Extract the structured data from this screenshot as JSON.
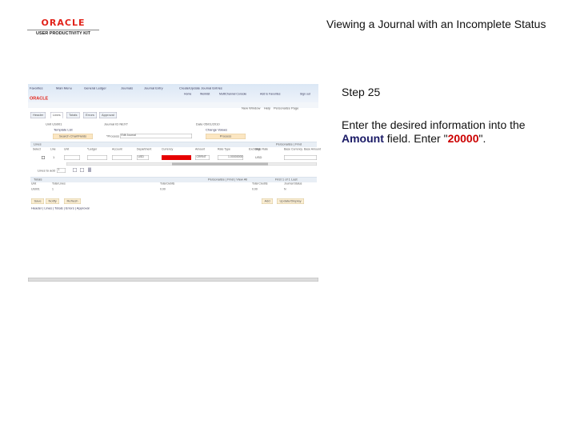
{
  "logo": {
    "brand": "ORACLE",
    "product": "USER PRODUCTIVITY KIT"
  },
  "slide": {
    "title": "Viewing a Journal with an Incomplete Status",
    "step": "Step 25",
    "instr_pre": "Enter the desired information into the ",
    "instr_field": "Amount",
    "instr_mid": " field. Enter \"",
    "instr_value": "20000",
    "instr_post": "\"."
  },
  "app": {
    "breadcrumbs": [
      "Favorites",
      "Main Menu",
      "General Ledger",
      "Journals",
      "Journal Entry",
      "Create/Update Journal Entries"
    ],
    "top_links": [
      "Home",
      "Worklist",
      "MultiChannel Console",
      "Add to Favorites",
      "Sign out"
    ],
    "page_links": [
      "New Window",
      "Help",
      "Personalize Page"
    ],
    "tabs": [
      "Header",
      "Lines",
      "Totals",
      "Errors",
      "Approval"
    ],
    "unit": "Unit US001",
    "journal_id": "Journal ID NEXT",
    "date": "Date 05/01/2010",
    "template_list": "Template List",
    "change_values": "Change Values",
    "search_chartfields": "Search ChartFields",
    "process_label": "*Process",
    "process_value": "Edit Journal",
    "process_btn": "Process",
    "lines": {
      "title": "Lines",
      "nav": "Personalize | Find",
      "cols": [
        "Select",
        "Line",
        "Unit",
        "*Ledger",
        "Account",
        "Department",
        "Currency",
        "Amount",
        "Rate Type",
        "Exchange Rate",
        "Stat",
        "Base Currency",
        "Base Amount"
      ],
      "row": {
        "line": "1",
        "currency": "USD",
        "rate_type": "CRRNT",
        "exchange_rate": "1.00000000",
        "base_currency": "USD"
      },
      "lines_to_add": "Lines to add",
      "lines_to_add_value": "1"
    },
    "totals": {
      "title": "Totals",
      "nav": "Personalize | Find | View All",
      "paging": "First 1 of 1 Last",
      "cols": [
        "Unit",
        "Total Lines",
        "Total Debits",
        "Total Credits",
        "Journal Status"
      ],
      "row": [
        "US001",
        "1",
        "0.00",
        "0.00",
        "N"
      ]
    },
    "buttons": [
      "Save",
      "Notify",
      "Refresh",
      "Add",
      "Update/Display"
    ],
    "bottom_links": "Header | Lines | Totals | Errors | Approval"
  }
}
